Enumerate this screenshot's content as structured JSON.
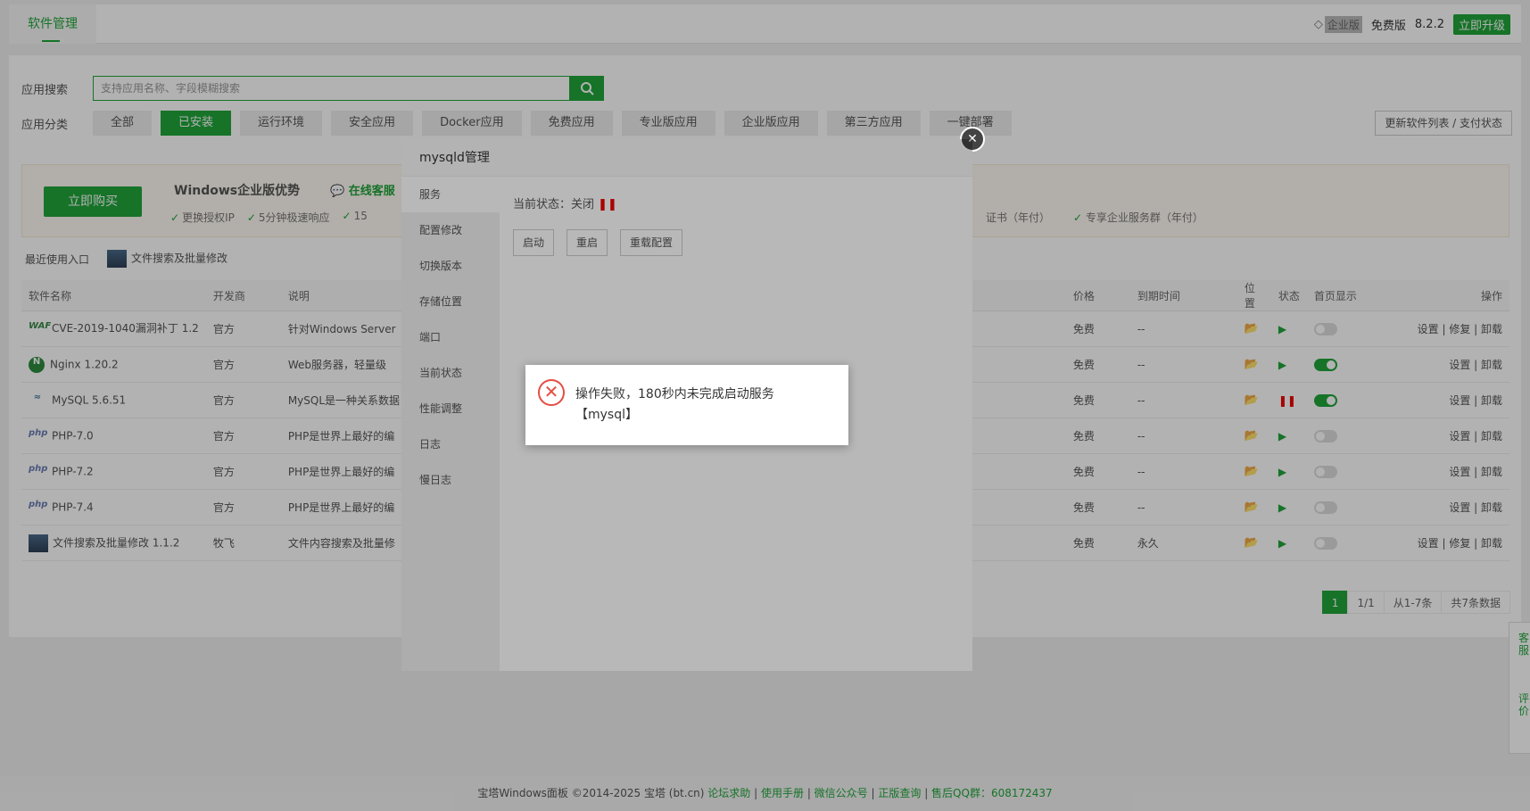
{
  "topbar": {
    "tab_label": "软件管理",
    "enterprise_label": "企业版",
    "free_label": "免费版",
    "version": "8.2.2",
    "upgrade_label": "立即升级"
  },
  "search": {
    "label": "应用搜索",
    "placeholder": "支持应用名称、字段模糊搜索"
  },
  "categories": {
    "label": "应用分类",
    "items": [
      "全部",
      "已安装",
      "运行环境",
      "安全应用",
      "Docker应用",
      "免费应用",
      "专业版应用",
      "企业版应用",
      "第三方应用",
      "一键部署"
    ],
    "active": "已安装",
    "refresh_label": "更新软件列表 / 支付状态"
  },
  "promo": {
    "buy_label": "立即购买",
    "title": "Windows企业版优势",
    "kf_label": "在线客服",
    "features": [
      "更换授权IP",
      "5分钟极速响应",
      "15"
    ],
    "features_right": [
      "证书（年付）",
      "专享企业服务群（年付）"
    ]
  },
  "recent": {
    "label": "最近使用入口",
    "item": "文件搜索及批量修改"
  },
  "table": {
    "headers": {
      "name": "软件名称",
      "dev": "开发商",
      "desc": "说明",
      "price": "价格",
      "expire": "到期时间",
      "location": "位置",
      "status": "状态",
      "home": "首页显示",
      "ops": "操作"
    },
    "rows": [
      {
        "name": "CVE-2019-1040漏洞补丁 1.2",
        "icon": "waf-icon",
        "icon_text": "WAF",
        "dev": "官方",
        "desc": "针对Windows Server",
        "price": "免费",
        "expire": "--",
        "ops": "设置 | 修复 | 卸载"
      },
      {
        "name": "Nginx 1.20.2",
        "icon": "nginx-icon",
        "icon_text": "N",
        "dev": "官方",
        "desc": "Web服务器，轻量级",
        "price": "免费",
        "expire": "--",
        "ops": "设置 | 卸载"
      },
      {
        "name": "MySQL 5.6.51",
        "icon": "mysql-icon",
        "icon_text": "≈",
        "dev": "官方",
        "desc": "MySQL是一种关系数据",
        "price": "免费",
        "expire": "--",
        "ops": "设置 | 卸载"
      },
      {
        "name": "PHP-7.0",
        "icon": "php-icon",
        "icon_text": "php",
        "dev": "官方",
        "desc": "PHP是世界上最好的编",
        "price": "免费",
        "expire": "--",
        "ops": "设置 | 卸载"
      },
      {
        "name": "PHP-7.2",
        "icon": "php-icon",
        "icon_text": "php",
        "dev": "官方",
        "desc": "PHP是世界上最好的编",
        "price": "免费",
        "expire": "--",
        "ops": "设置 | 卸载"
      },
      {
        "name": "PHP-7.4",
        "icon": "php-icon",
        "icon_text": "php",
        "dev": "官方",
        "desc": "PHP是世界上最好的编",
        "price": "免费",
        "expire": "--",
        "ops": "设置 | 卸载"
      },
      {
        "name": "文件搜索及批量修改 1.1.2",
        "icon": "thumbnail-icon",
        "icon_text": "",
        "dev": "牧飞",
        "desc": "文件内容搜索及批量修",
        "price": "免费",
        "expire": "永久",
        "ops": "设置 | 修复 | 卸载"
      }
    ]
  },
  "pager": {
    "current": "1",
    "total_pages": "1/1",
    "range": "从1-7条",
    "count": "共7条数据"
  },
  "footer": {
    "copyright": "宝塔Windows面板 ©2014-2025 宝塔 (bt.cn)",
    "links": [
      "论坛求助",
      "使用手册",
      "微信公众号",
      "正版查询"
    ],
    "qq": "售后QQ群：608172437"
  },
  "side_float": {
    "kf": "客服",
    "rate": "评价"
  },
  "modal": {
    "title": "mysqld管理",
    "menu": [
      "服务",
      "配置修改",
      "切换版本",
      "存储位置",
      "端口",
      "当前状态",
      "性能调整",
      "日志",
      "慢日志"
    ],
    "status_label": "当前状态：关闭",
    "buttons": [
      "启动",
      "重启",
      "重载配置"
    ]
  },
  "toast": {
    "message": "操作失败，180秒内未完成启动服务【mysql】"
  },
  "colors": {
    "accent": "#20a53a",
    "error": "#e54d42"
  }
}
